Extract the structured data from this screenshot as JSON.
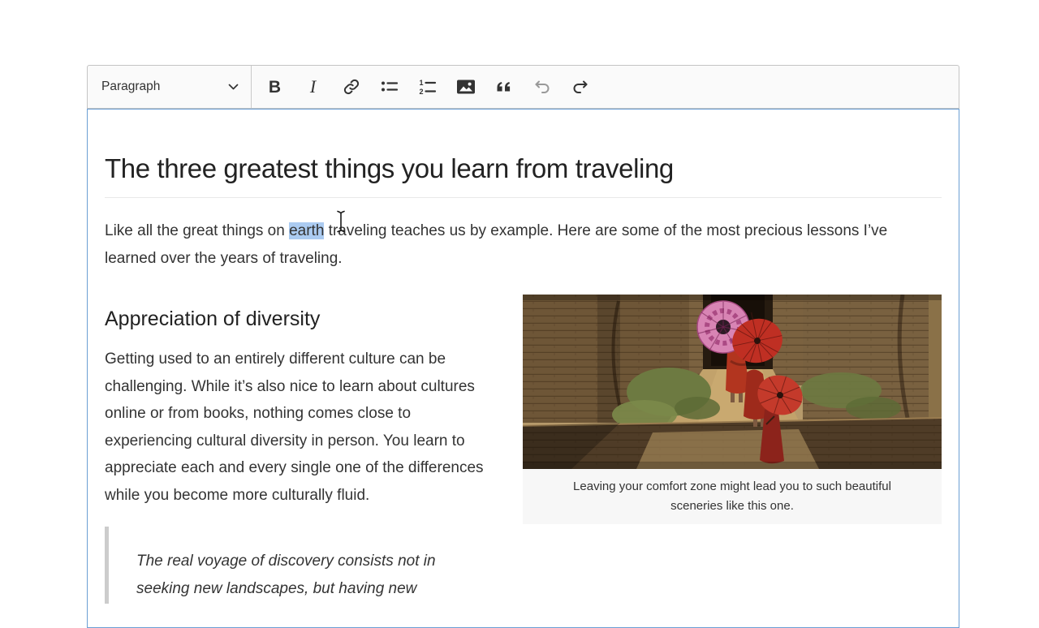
{
  "toolbar": {
    "dropdown_label": "Paragraph",
    "bold_glyph": "B",
    "italic_glyph": "I",
    "buttons": [
      "Bold",
      "Italic",
      "Link",
      "Bulleted List",
      "Numbered List",
      "Insert image",
      "Block quote",
      "Undo",
      "Redo"
    ]
  },
  "doc": {
    "title": "The three greatest things you learn from traveling",
    "intro_before": "Like all the great things on ",
    "intro_selected": "earth",
    "intro_after": " traveling teaches us by example. Here are some of the most precious lessons I’ve learned over the years of traveling.",
    "section_heading": "Appreciation of diversity",
    "section_body": "Getting used to an entirely different culture can be challenging. While it’s also nice to learn about cultures online or from books, nothing comes close to experiencing cultural diversity in person. You learn to appreciate each and every single one of the differences while you become more culturally fluid.",
    "quote_visible": "The real voyage of discovery consists not in seeking new landscapes, but having new",
    "image_caption": "Leaving your comfort zone might lead you to such beautiful sceneries like this one."
  },
  "colors": {
    "selection_highlight": "#abcbf1",
    "focus_border": "#6b9fd4",
    "toolbar_bg": "#fafafa",
    "toolbar_border": "#c4c4c4",
    "text": "#333333",
    "caption_bg": "#f7f7f7",
    "quote_bar": "#cccccc",
    "undo_disabled": "#999999"
  }
}
